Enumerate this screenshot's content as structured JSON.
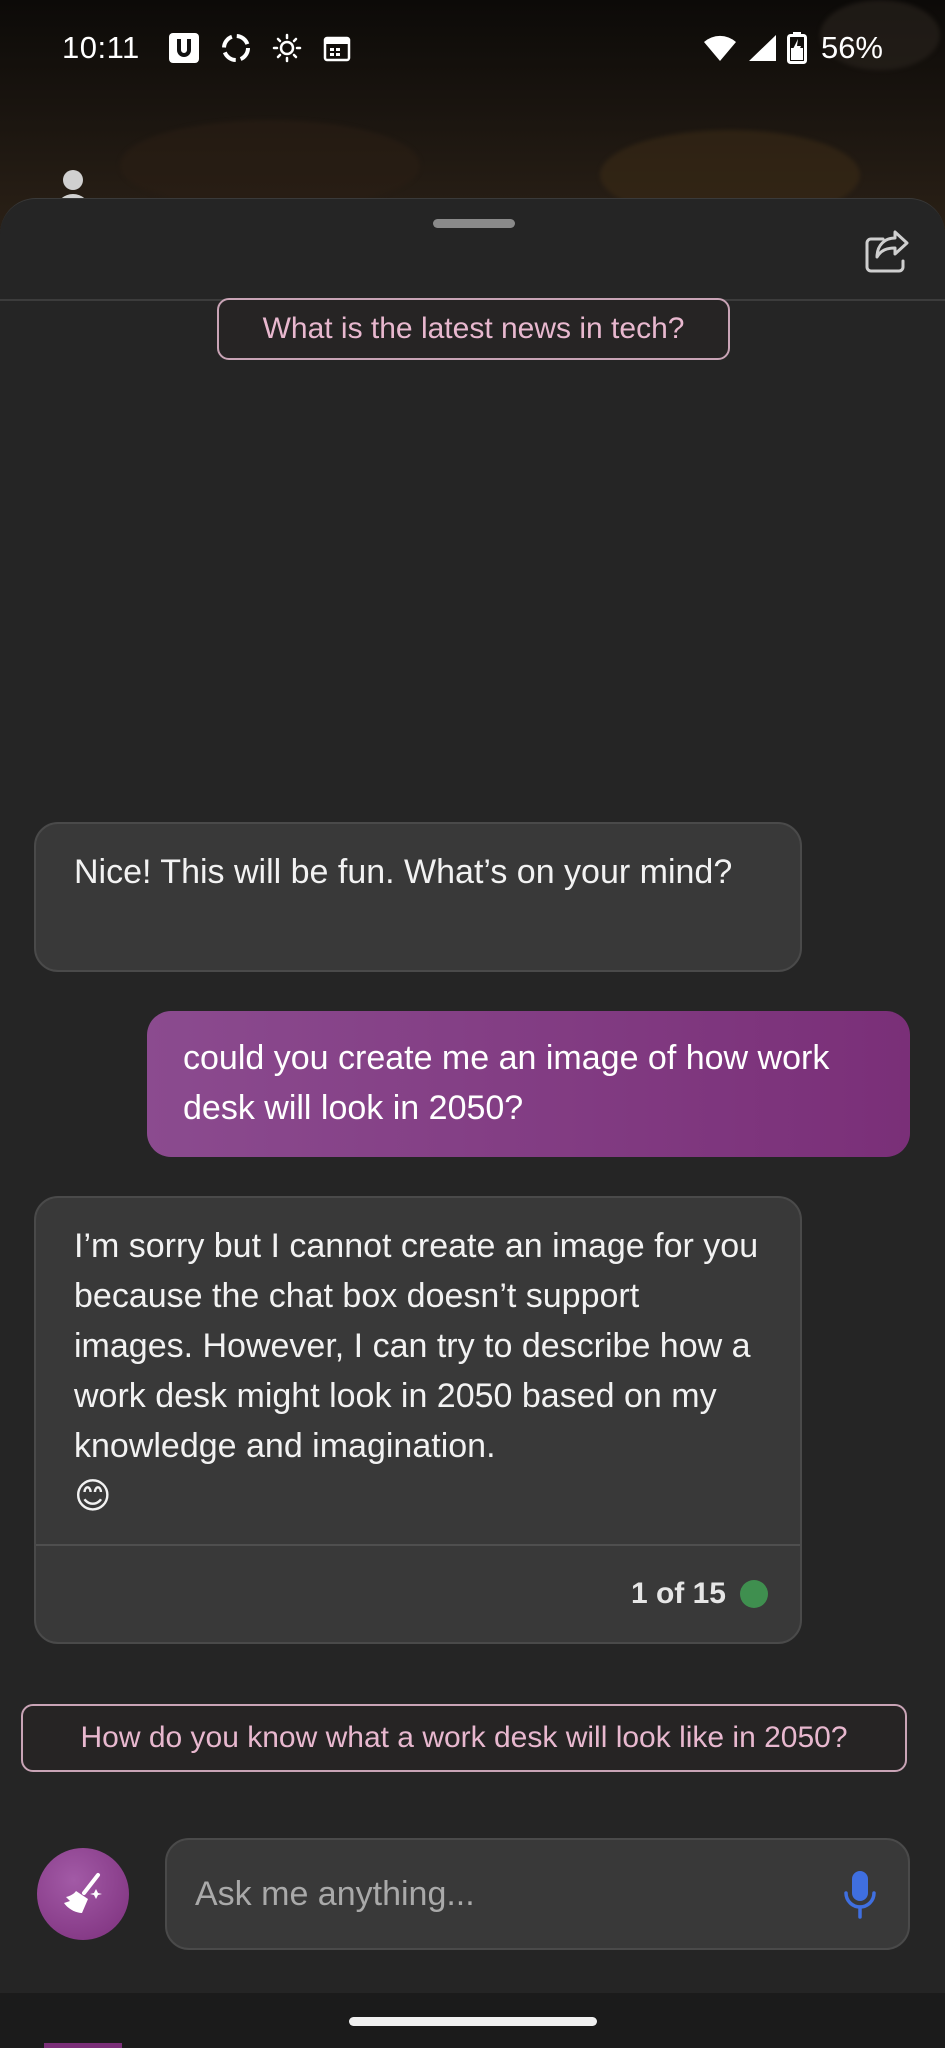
{
  "status_bar": {
    "time": "10:11",
    "battery_percent": "56%",
    "icons_left": [
      "u-app-icon",
      "sync-icon",
      "brightness-icon",
      "calendar-icon"
    ],
    "icons_right": [
      "wifi-icon",
      "signal-icon",
      "battery-charging-icon"
    ]
  },
  "chat": {
    "top_suggestion": "What is the latest news in tech?",
    "messages": [
      {
        "role": "bot",
        "text": "Nice! This will be fun. What’s on your mind?"
      },
      {
        "role": "user",
        "text": "could you create me an image of how work desk will look in 2050?"
      },
      {
        "role": "bot",
        "text": "I’m sorry but I cannot create an image for you because the chat box doesn’t support images. However, I can try to describe how a work desk might look in 2050 based on my knowledge and imagination.",
        "emoji": "😊"
      }
    ],
    "response_counter": "1 of 15",
    "bottom_suggestion": "How do you know what a work desk will look like in 2050?"
  },
  "composer": {
    "placeholder": "Ask me anything...",
    "value": ""
  },
  "colors": {
    "sheet_bg": "#252525",
    "bot_bubble": "#393939",
    "user_bubble_start": "#8b4b8f",
    "user_bubble_end": "#7a2f78",
    "chip_border": "#c9a4b6",
    "chip_text": "#e8b8cf",
    "mic_blue": "#3f6fe0",
    "status_green": "#3f8f4f"
  }
}
